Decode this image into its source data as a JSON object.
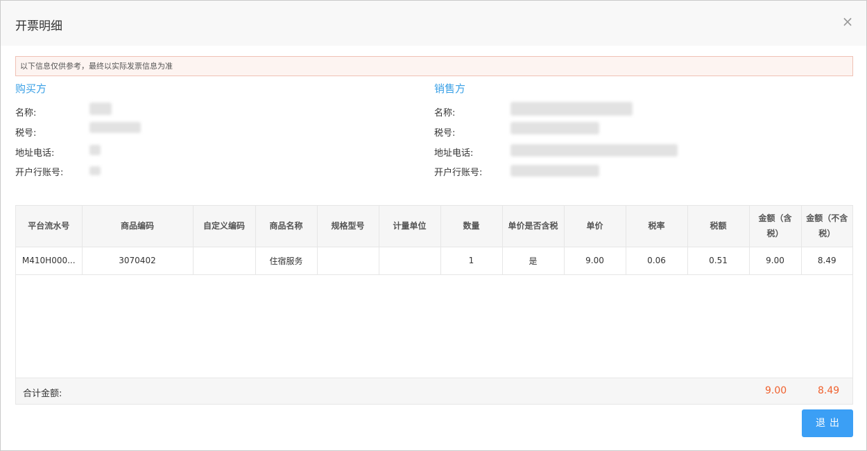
{
  "dialog": {
    "title": "开票明细",
    "close_glyph": "×",
    "notice": "以下信息仅供参考，最终以实际发票信息为准",
    "exit_label": "退出"
  },
  "buyer": {
    "title": "购买方",
    "labels": {
      "name": "名称:",
      "tax_no": "税号:",
      "address_phone": "地址电话:",
      "bank_account": "开户行账号:"
    }
  },
  "seller": {
    "title": "销售方",
    "labels": {
      "name": "名称:",
      "tax_no": "税号:",
      "address_phone": "地址电话:",
      "bank_account": "开户行账号:"
    }
  },
  "table": {
    "columns": [
      "平台流水号",
      "商品编码",
      "自定义编码",
      "商品名称",
      "规格型号",
      "计量单位",
      "数量",
      "单价是否含税",
      "单价",
      "税率",
      "税额",
      "金额（含税）",
      "金额（不含税）"
    ],
    "rows": [
      [
        "M410H000...",
        "3070402",
        "",
        "住宿服务",
        "",
        "",
        "1",
        "是",
        "9.00",
        "0.06",
        "0.51",
        "9.00",
        "8.49"
      ]
    ],
    "total_label": "合计金额:",
    "total_with_tax": "9.00",
    "total_without_tax": "8.49"
  },
  "colors": {
    "accent": "#3b9ff5",
    "section_title": "#3aa0e6",
    "total_value": "#f0612e"
  },
  "icons": {
    "close": "close-icon"
  }
}
